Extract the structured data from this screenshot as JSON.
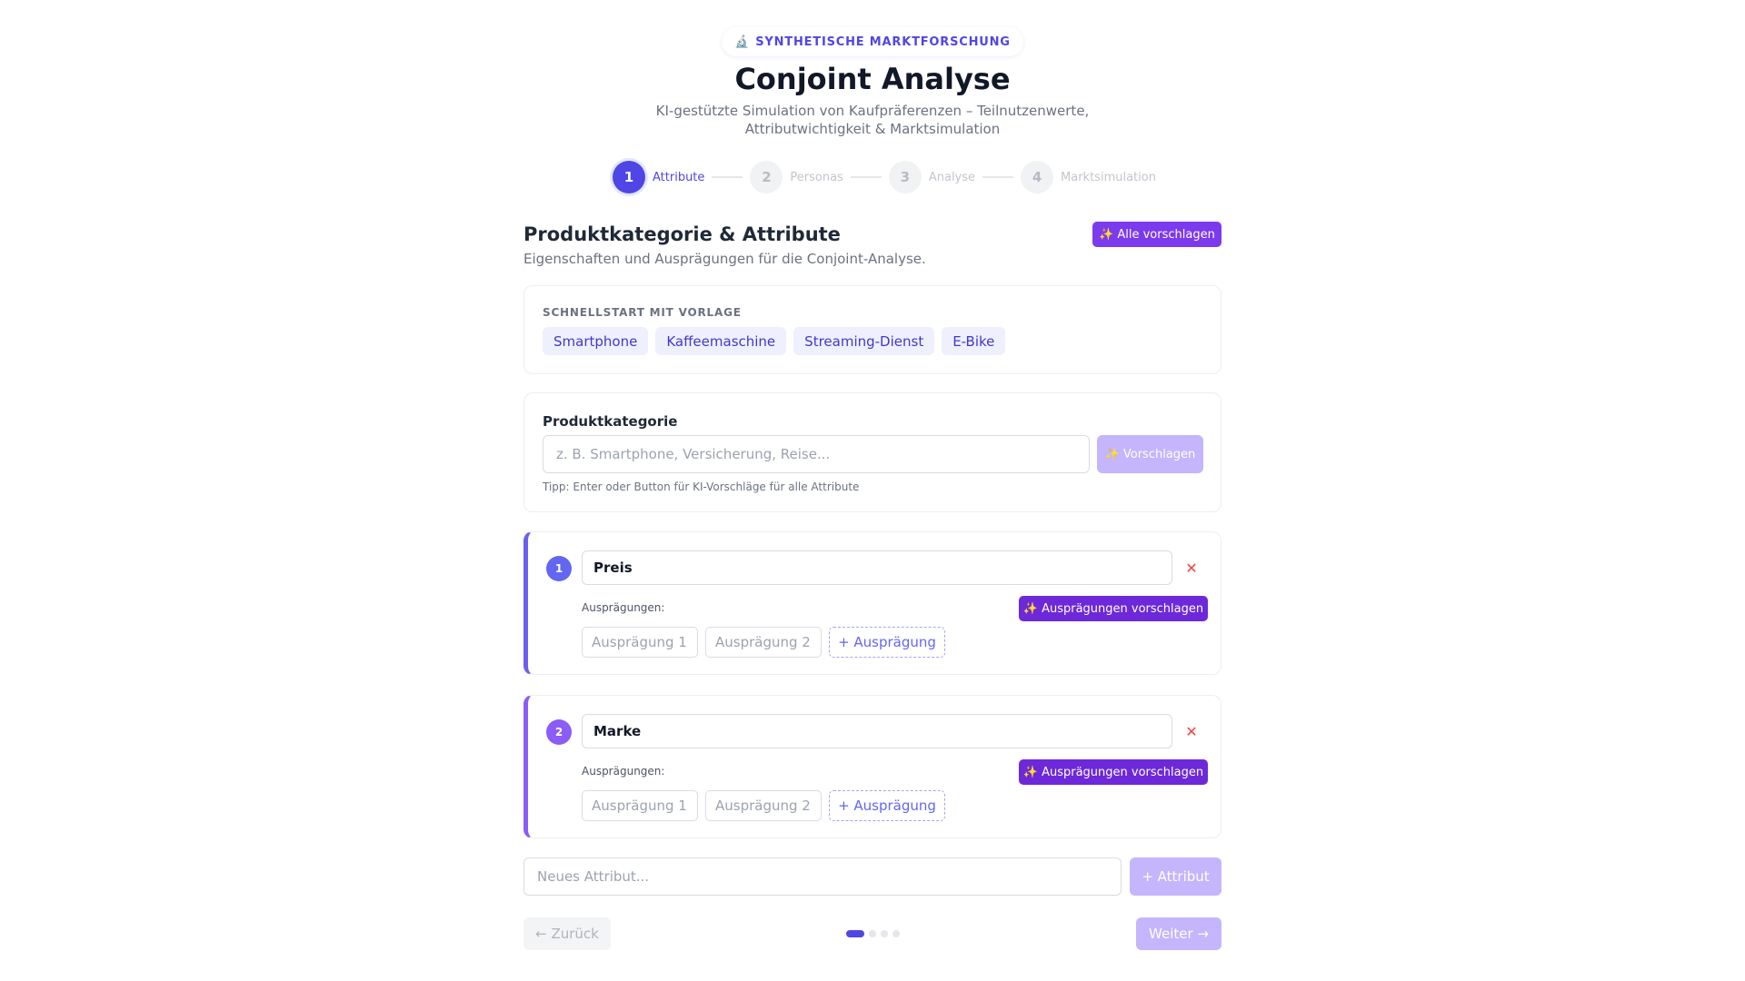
{
  "header": {
    "badge_icon": "microscope-icon",
    "badge_glyph": "🔬",
    "badge": "SYNTHETISCHE MARKTFORSCHUNG",
    "title": "Conjoint Analyse",
    "subtitle": "KI-gestützte Simulation von Kaufpräferenzen – Teilnutzenwerte, Attributwichtigkeit & Marktsimulation"
  },
  "stepper": {
    "steps": [
      {
        "number": "1",
        "label": "Attribute",
        "active": true
      },
      {
        "number": "2",
        "label": "Personas",
        "active": false
      },
      {
        "number": "3",
        "label": "Analyse",
        "active": false
      },
      {
        "number": "4",
        "label": "Marktsimulation",
        "active": false
      }
    ]
  },
  "section": {
    "title": "Produktkategorie & Attribute",
    "description": "Eigenschaften und Ausprägungen für die Conjoint-Analyse.",
    "suggest_all_label": "Alle vorschlagen",
    "sparkle_glyph": "✨"
  },
  "templates": {
    "heading": "SCHNELLSTART MIT VORLAGE",
    "items": [
      "Smartphone",
      "Kaffeemaschine",
      "Streaming-Dienst",
      "E-Bike"
    ]
  },
  "category": {
    "label": "Produktkategorie",
    "placeholder": "z. B. Smartphone, Versicherung, Reise...",
    "value": "",
    "suggest_label": "Vorschlagen",
    "hint": "Tipp: Enter oder Button für KI-Vorschläge für alle Attribute"
  },
  "attributes": [
    {
      "number": "1",
      "name": "Preis",
      "remove_glyph": "✕",
      "levels_label": "Ausprägungen:",
      "suggest_label": "Ausprägungen vorschlagen",
      "levels": [
        "Ausprägung 1",
        "Ausprägung 2"
      ],
      "add_level_label": "+ Ausprägung"
    },
    {
      "number": "2",
      "name": "Marke",
      "remove_glyph": "✕",
      "levels_label": "Ausprägungen:",
      "suggest_label": "Ausprägungen vorschlagen",
      "levels": [
        "Ausprägung 1",
        "Ausprägung 2"
      ],
      "add_level_label": "+ Ausprägung"
    }
  ],
  "new_attribute": {
    "placeholder": "Neues Attribut...",
    "add_label": "+ Attribut"
  },
  "footer": {
    "back_label": "← Zurück",
    "next_label": "Weiter →",
    "current_page": 1,
    "total_pages": 4
  },
  "colors": {
    "accent": "#4f46e5",
    "violet": "#7c3aed",
    "disabled_violet": "#c4b5fd",
    "danger": "#ef4444"
  }
}
